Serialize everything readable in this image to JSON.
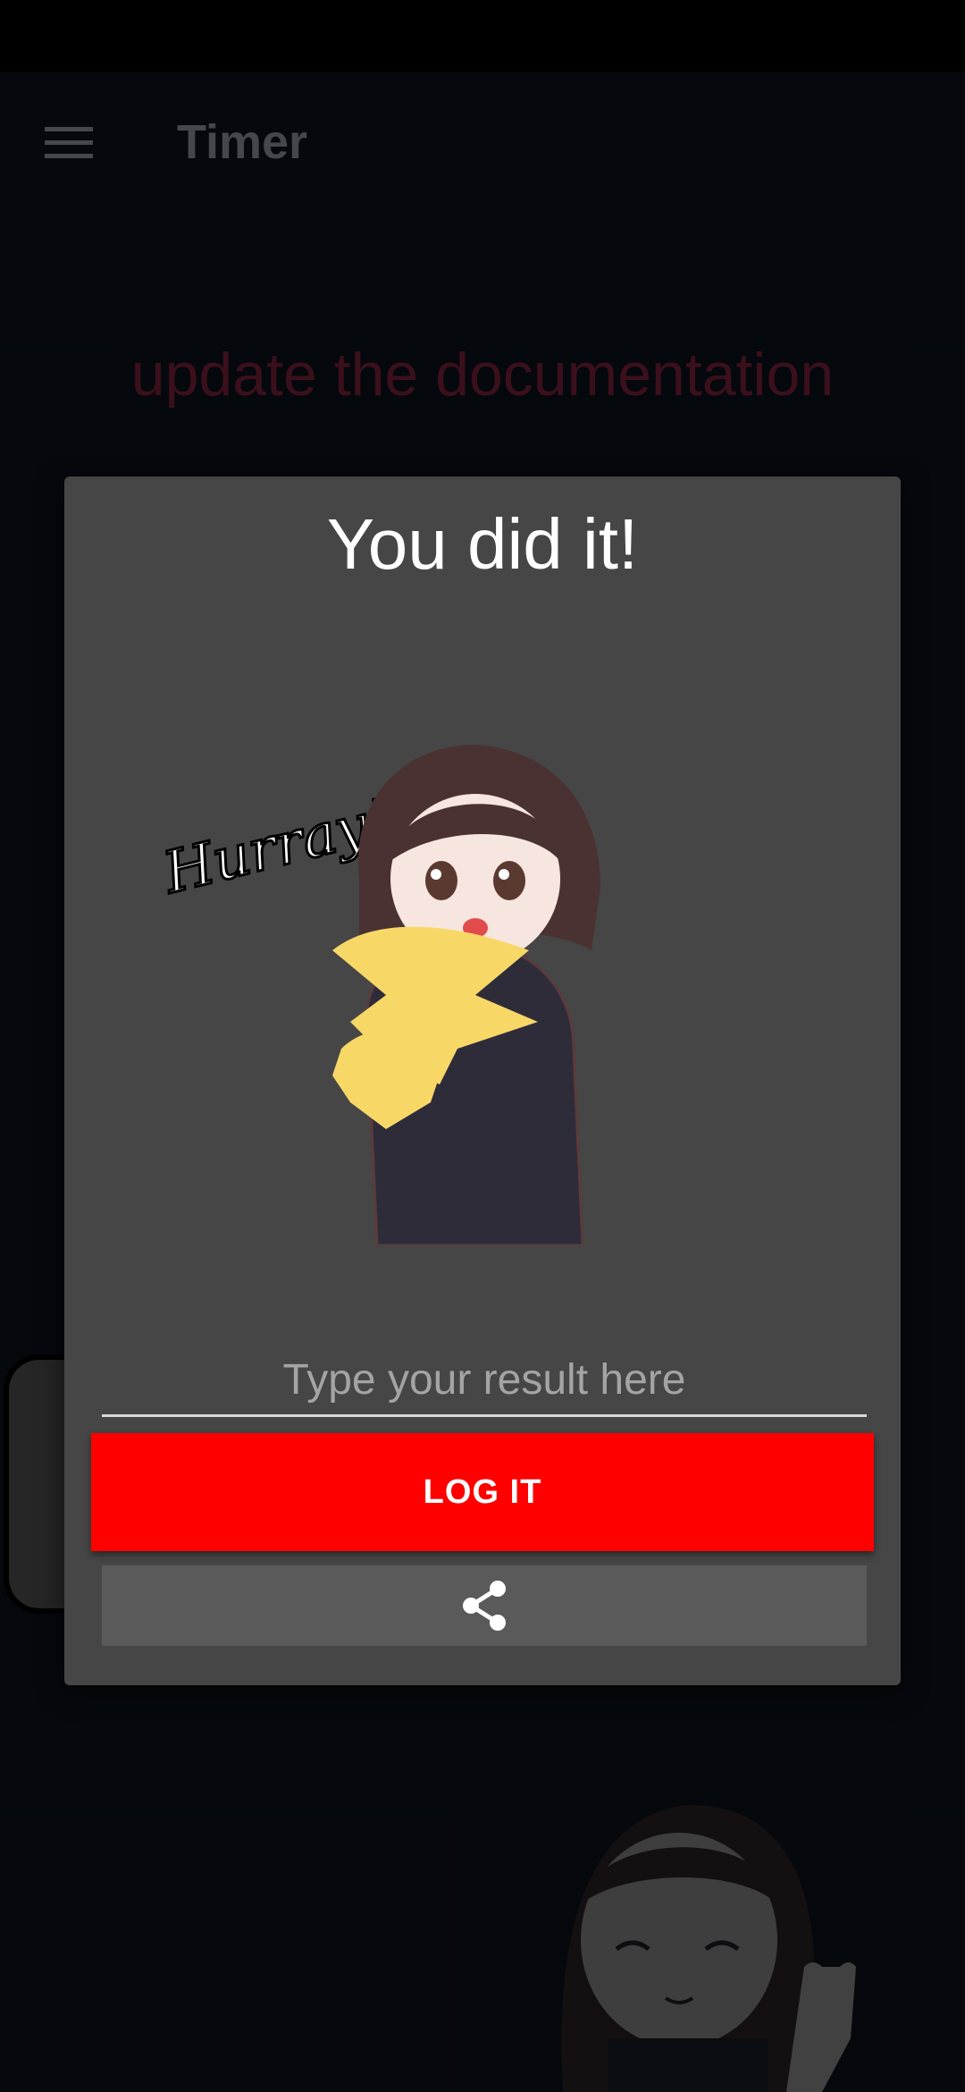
{
  "toolbar": {
    "menu_icon": "hamburger-menu-icon",
    "title": "Timer"
  },
  "task": {
    "name": "update the documentation"
  },
  "dialog": {
    "title": "You did it!",
    "sticker_caption": "Hurray!",
    "result_placeholder": "Type your result here",
    "result_value": "",
    "log_button_label": "LOG IT",
    "share_icon": "share-icon"
  },
  "colors": {
    "background": "#090d14",
    "task_name": "#5b1a2c",
    "dialog": "#464646",
    "log_button": "#ff0000",
    "share_button": "#5a5a5a"
  }
}
